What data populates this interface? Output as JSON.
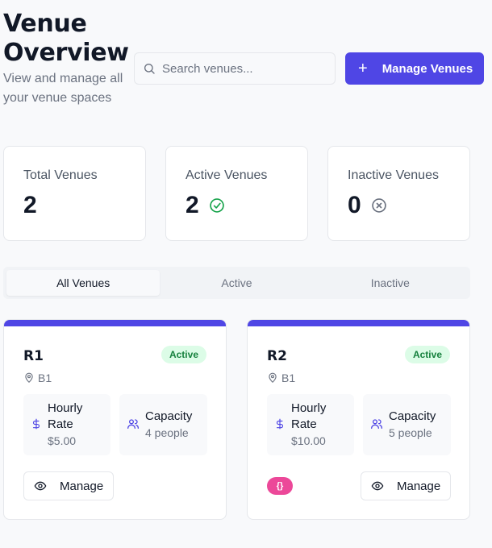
{
  "header": {
    "title": "Venue Overview",
    "subtitle": "View and manage all your venue spaces"
  },
  "search": {
    "placeholder": "Search venues...",
    "value": ""
  },
  "actions": {
    "manage_label": "Manage Venues",
    "manage_icon": "plus-icon"
  },
  "stats": [
    {
      "label": "Total Venues",
      "value": "2"
    },
    {
      "label": "Active Venues",
      "value": "2",
      "icon": "check-circle-icon",
      "color": "#16a34a"
    },
    {
      "label": "Inactive Venues",
      "value": "0",
      "icon": "x-circle-icon",
      "color": "#6b7280"
    }
  ],
  "tabs": [
    {
      "label": "All Venues",
      "active": true
    },
    {
      "label": "Active",
      "active": false
    },
    {
      "label": "Inactive",
      "active": false
    }
  ],
  "venues": [
    {
      "name": "R1",
      "status": "Active",
      "location": "B1",
      "rate_label": "Hourly Rate",
      "rate_value": "$5.00",
      "capacity_label": "Capacity",
      "capacity_value": "4 people",
      "manage_label": "Manage"
    },
    {
      "name": "R2",
      "status": "Active",
      "location": "B1",
      "rate_label": "Hourly Rate",
      "rate_value": "$10.00",
      "capacity_label": "Capacity",
      "capacity_value": "5 people",
      "manage_label": "Manage",
      "badge": "{}"
    }
  ],
  "colors": {
    "accent": "#4f46e5",
    "active_badge_bg": "#dcfce7",
    "active_badge_text": "#15803d",
    "dev_badge": "#ec4899"
  }
}
